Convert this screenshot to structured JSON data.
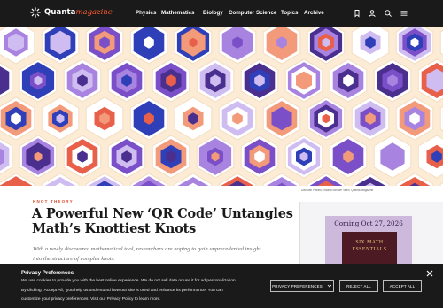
{
  "header": {
    "logo_main": "Quanta",
    "logo_accent": "magazine",
    "nav": [
      "Physics",
      "Mathematics",
      "Biology",
      "Computer Science",
      "Topics",
      "Archive"
    ],
    "icons": [
      "bookmark-icon",
      "user-icon",
      "search-icon",
      "menu-icon"
    ]
  },
  "hero": {
    "credit": "Dan Van Paines; Roland van der Veen; Quanta Magazine"
  },
  "article": {
    "kicker": "KNOT THEORY",
    "headline": "A Powerful New ‘QR Code’ Untangles Math’s Knottiest Knots",
    "deck": "With a newly discovered mathematical tool, researchers are hoping to gain unprecedented insight into the structure of complex knots."
  },
  "promo": {
    "date": "Coming Oct 27, 2026",
    "book_title": "SIX MATH ESSENTIALS"
  },
  "privacy": {
    "title": "Privacy Preferences",
    "text": "We use cookies to provide you with the best online experience. We do not sell data or use it for ad personalization. By clicking “Accept All,” you help us understand how our site is used and enhance its performance. You can customize your privacy preferences. Visit our Privacy Policy to learn more.",
    "btn_prefs": "PRIVACY PREFERENCES",
    "btn_reject": "REJECT ALL",
    "btn_accept": "ACCEPT ALL"
  },
  "colors": {
    "header_bg": "#1a1a1a",
    "accent": "#ff5a2d",
    "kicker": "#d8492b",
    "hero_bg": "#fcecd6"
  }
}
